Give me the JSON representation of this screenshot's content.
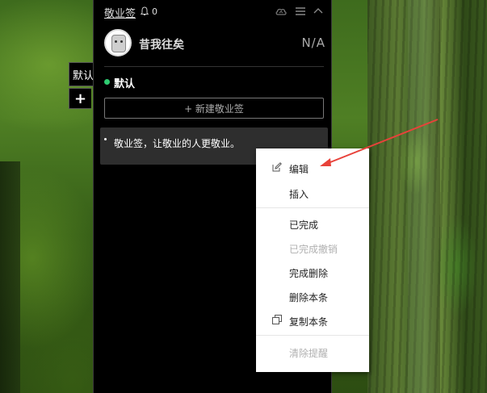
{
  "app": {
    "title": "敬业签",
    "notification_count": "0"
  },
  "user": {
    "name": "昔我往矣",
    "status": "N/A"
  },
  "side_tabs": {
    "default_label": "默认",
    "add_label": "+"
  },
  "group": {
    "name": "默认",
    "dot_color": "#2ecc71"
  },
  "new_note_button": "+ 新建敬业签",
  "note": {
    "text": "敬业签，让敬业的人更敬业。"
  },
  "context_menu": {
    "items": [
      {
        "label": "编辑",
        "icon": "edit-icon",
        "enabled": true
      },
      {
        "label": "插入",
        "enabled": true
      },
      {
        "label": "已完成",
        "enabled": true
      },
      {
        "label": "已完成撤销",
        "enabled": false
      },
      {
        "label": "完成删除",
        "enabled": true
      },
      {
        "label": "删除本条",
        "enabled": true
      },
      {
        "label": "复制本条",
        "icon": "copy-icon",
        "enabled": true
      },
      {
        "label": "清除提醒",
        "enabled": false
      }
    ]
  },
  "annotation": {
    "arrow_color": "#e8423a"
  }
}
